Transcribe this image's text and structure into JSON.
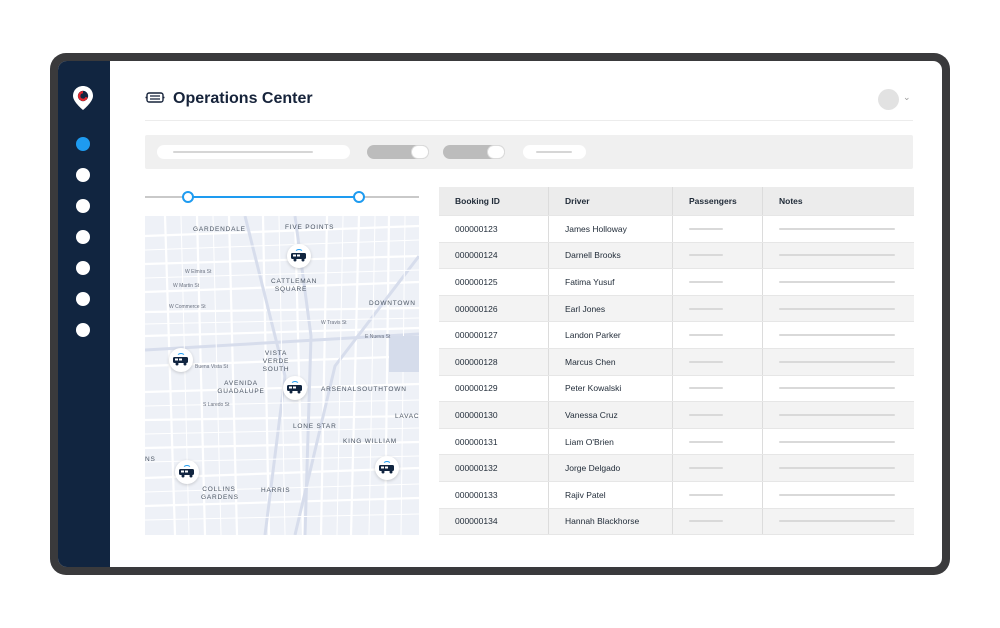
{
  "header": {
    "title": "Operations Center"
  },
  "sidebar": {
    "logo_icon": "location-pin-logo",
    "nav_items": [
      {
        "id": "nav-1",
        "active": true
      },
      {
        "id": "nav-2",
        "active": false
      },
      {
        "id": "nav-3",
        "active": false
      },
      {
        "id": "nav-4",
        "active": false
      },
      {
        "id": "nav-5",
        "active": false
      },
      {
        "id": "nav-6",
        "active": false
      },
      {
        "id": "nav-7",
        "active": false
      }
    ]
  },
  "colors": {
    "sidebar": "#112540",
    "accent": "#1e9bf0",
    "frame": "#3a3a3c"
  },
  "map": {
    "neighborhoods": [
      "GARDENDALE",
      "FIVE POINTS",
      "CATTLEMAN SQUARE",
      "DOWNTOWN",
      "VISTA VERDE SOUTH",
      "AVENIDA GUADALUPE",
      "ARSENAL",
      "SOUTHTOWN",
      "LONE STAR",
      "KING WILLIAM",
      "LAVACA",
      "COLLINS GARDENS",
      "HARRIS",
      "NS"
    ],
    "streets": [
      "W Elmira St",
      "W Martin St",
      "W Commerce St",
      "W Travis St",
      "W Nueva St",
      "S Frio St",
      "S Flores St",
      "Buena Vista St",
      "S Laredo St",
      "S Zarzamora St",
      "Nogalitos St",
      "Probandt St",
      "S Alamo St",
      "Roosevelt Ave",
      "S Presa St",
      "E Nueva St",
      "Fredericksburg Rd"
    ],
    "vehicles": [
      "van-1",
      "van-2",
      "van-3",
      "van-4",
      "van-5"
    ]
  },
  "table": {
    "columns": [
      "Booking ID",
      "Driver",
      "Passengers",
      "Notes"
    ],
    "rows": [
      {
        "id": "000000123",
        "driver": "James Holloway"
      },
      {
        "id": "000000124",
        "driver": "Darnell Brooks"
      },
      {
        "id": "000000125",
        "driver": "Fatima Yusuf"
      },
      {
        "id": "000000126",
        "driver": "Earl Jones"
      },
      {
        "id": "000000127",
        "driver": "Landon Parker"
      },
      {
        "id": "000000128",
        "driver": "Marcus Chen"
      },
      {
        "id": "000000129",
        "driver": "Peter Kowalski"
      },
      {
        "id": "000000130",
        "driver": "Vanessa Cruz"
      },
      {
        "id": "000000131",
        "driver": "Liam O'Brien"
      },
      {
        "id": "000000132",
        "driver": "Jorge Delgado"
      },
      {
        "id": "000000133",
        "driver": "Rajiv Patel"
      },
      {
        "id": "000000134",
        "driver": "Hannah Blackhorse"
      }
    ]
  }
}
